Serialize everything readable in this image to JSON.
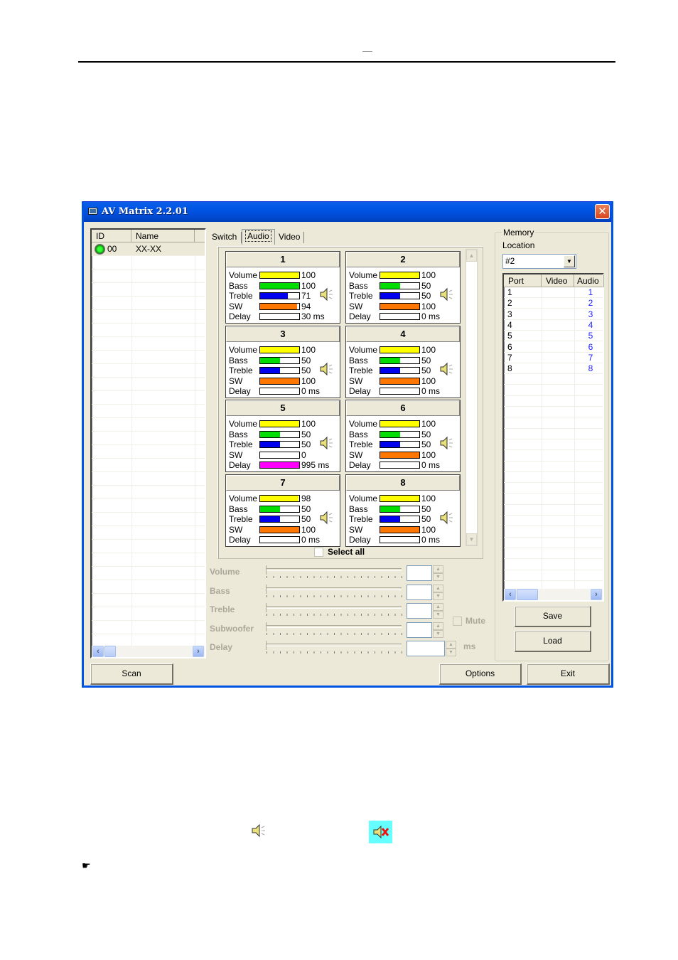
{
  "window": {
    "title": "AV Matrix 2.2.01",
    "close_symbol": "✕"
  },
  "device_list": {
    "columns": [
      "ID",
      "Name"
    ],
    "rows": [
      {
        "id": "00",
        "name": "XX-XX",
        "status": "online"
      }
    ]
  },
  "tabs": [
    {
      "label": "Switch",
      "active": false
    },
    {
      "label": "Audio",
      "active": true
    },
    {
      "label": "Video",
      "active": false
    }
  ],
  "channel_labels": [
    "Volume",
    "Bass",
    "Treble",
    "SW",
    "Delay"
  ],
  "bar_colors": {
    "Volume": "#ffff00",
    "Bass": "#00dd00",
    "Treble": "#0000ee",
    "SW": "#ff7700",
    "Delay": "#ff00ff"
  },
  "channels": [
    {
      "name": "1",
      "muted": false,
      "values": {
        "Volume": "100",
        "Bass": "100",
        "Treble": "71",
        "SW": "94",
        "Delay": "30 ms"
      },
      "levels": {
        "Volume": 1.0,
        "Bass": 1.0,
        "Treble": 0.71,
        "SW": 0.94,
        "Delay": 0.0
      }
    },
    {
      "name": "2",
      "muted": false,
      "values": {
        "Volume": "100",
        "Bass": "50",
        "Treble": "50",
        "SW": "100",
        "Delay": "0 ms"
      },
      "levels": {
        "Volume": 1.0,
        "Bass": 0.5,
        "Treble": 0.5,
        "SW": 1.0,
        "Delay": 0.0
      }
    },
    {
      "name": "3",
      "muted": false,
      "values": {
        "Volume": "100",
        "Bass": "50",
        "Treble": "50",
        "SW": "100",
        "Delay": "0 ms"
      },
      "levels": {
        "Volume": 1.0,
        "Bass": 0.5,
        "Treble": 0.5,
        "SW": 1.0,
        "Delay": 0.0
      }
    },
    {
      "name": "4",
      "muted": false,
      "values": {
        "Volume": "100",
        "Bass": "50",
        "Treble": "50",
        "SW": "100",
        "Delay": "0 ms"
      },
      "levels": {
        "Volume": 1.0,
        "Bass": 0.5,
        "Treble": 0.5,
        "SW": 1.0,
        "Delay": 0.0
      }
    },
    {
      "name": "5",
      "muted": false,
      "values": {
        "Volume": "100",
        "Bass": "50",
        "Treble": "50",
        "SW": "0",
        "Delay": "995 ms"
      },
      "levels": {
        "Volume": 1.0,
        "Bass": 0.5,
        "Treble": 0.5,
        "SW": 0.0,
        "Delay": 1.0
      }
    },
    {
      "name": "6",
      "muted": false,
      "values": {
        "Volume": "100",
        "Bass": "50",
        "Treble": "50",
        "SW": "100",
        "Delay": "0 ms"
      },
      "levels": {
        "Volume": 1.0,
        "Bass": 0.5,
        "Treble": 0.5,
        "SW": 1.0,
        "Delay": 0.0
      }
    },
    {
      "name": "7",
      "muted": false,
      "values": {
        "Volume": "98",
        "Bass": "50",
        "Treble": "50",
        "SW": "100",
        "Delay": "0 ms"
      },
      "levels": {
        "Volume": 0.98,
        "Bass": 0.5,
        "Treble": 0.5,
        "SW": 1.0,
        "Delay": 0.0
      }
    },
    {
      "name": "8",
      "muted": false,
      "values": {
        "Volume": "100",
        "Bass": "50",
        "Treble": "50",
        "SW": "100",
        "Delay": "0 ms"
      },
      "levels": {
        "Volume": 1.0,
        "Bass": 0.5,
        "Treble": 0.5,
        "SW": 1.0,
        "Delay": 0.0
      }
    }
  ],
  "select_all": {
    "label": "Select all",
    "checked": false
  },
  "sliders": [
    {
      "label": "Volume",
      "value": ""
    },
    {
      "label": "Bass",
      "value": ""
    },
    {
      "label": "Treble",
      "value": ""
    },
    {
      "label": "Subwoofer",
      "value": ""
    },
    {
      "label": "Delay",
      "value": ""
    }
  ],
  "mute": {
    "label": "Mute",
    "checked": false
  },
  "delay_unit": "ms",
  "memory": {
    "group_label": "Memory",
    "location_label": "Location",
    "location_value": "#2",
    "columns": [
      "Port",
      "Video",
      "Audio"
    ],
    "rows": [
      {
        "port": "1",
        "video": "",
        "audio": "1"
      },
      {
        "port": "2",
        "video": "",
        "audio": "2"
      },
      {
        "port": "3",
        "video": "",
        "audio": "3"
      },
      {
        "port": "4",
        "video": "",
        "audio": "4"
      },
      {
        "port": "5",
        "video": "",
        "audio": "5"
      },
      {
        "port": "6",
        "video": "",
        "audio": "6"
      },
      {
        "port": "7",
        "video": "",
        "audio": "7"
      },
      {
        "port": "8",
        "video": "",
        "audio": "8"
      }
    ],
    "save_label": "Save",
    "load_label": "Load"
  },
  "buttons": {
    "scan": "Scan",
    "options": "Options",
    "exit": "Exit"
  },
  "icons": {
    "speaker": "speaker-icon",
    "speaker_muted": "speaker-muted-icon",
    "pointer": "☛"
  }
}
